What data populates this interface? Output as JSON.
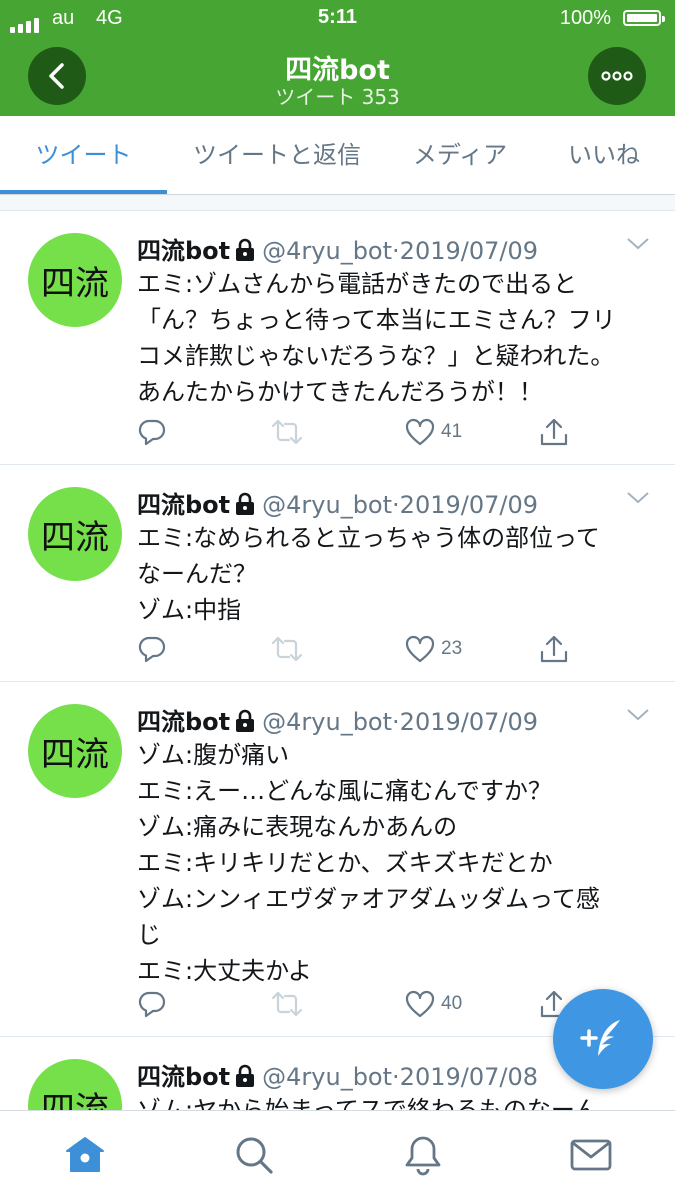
{
  "status_bar": {
    "carrier": "au",
    "network": "4G",
    "time": "5:11",
    "battery": "100%",
    "signal_bars": 4
  },
  "header": {
    "title": "四流bot",
    "subtitle": "ツイート 353",
    "color": "#47a534"
  },
  "tabs": [
    {
      "label": "ツイート",
      "active": true
    },
    {
      "label": "ツイートと返信",
      "active": false
    },
    {
      "label": "メディア",
      "active": false
    },
    {
      "label": "いいね",
      "active": false
    }
  ],
  "tweets": [
    {
      "avatar_text": "四流",
      "name": "四流bot",
      "handle": "@4ryu_bot",
      "date": "2019/07/09",
      "lines": [
        "エミ:ゾムさんから電話がきたので出ると",
        "「ん？ちょっと待って本当にエミさん？フリ",
        "コメ詐欺じゃないだろうな？」と疑われた。",
        "あんたからかけてきたんだろうが！！"
      ],
      "likes": "41"
    },
    {
      "avatar_text": "四流",
      "name": "四流bot",
      "handle": "@4ryu_bot",
      "date": "2019/07/09",
      "lines": [
        "エミ:なめられると立っちゃう体の部位って",
        "なーんだ？",
        "ゾム:中指"
      ],
      "likes": "23"
    },
    {
      "avatar_text": "四流",
      "name": "四流bot",
      "handle": "@4ryu_bot",
      "date": "2019/07/09",
      "lines": [
        "ゾム:腹が痛い",
        "エミ:えー…どんな風に痛むんですか？",
        "ゾム:痛みに表現なんかあんの",
        "エミ:キリキリだとか、ズキズキだとか",
        "ゾム:ンンィエヴダァオアダムッダムって感",
        "じ",
        "エミ:大丈夫かよ"
      ],
      "likes": "40"
    },
    {
      "avatar_text": "四流",
      "name": "四流bot",
      "handle": "@4ryu_bot",
      "date": "2019/07/08",
      "lines": [
        "ゾム:ヤから始まってスで終わるものなーん"
      ],
      "likes": ""
    }
  ],
  "icons": {
    "back": "chevron-left-icon",
    "more": "ellipsis-icon",
    "lock": "lock-icon",
    "caret": "chevron-down-icon",
    "reply": "reply-icon",
    "retweet": "retweet-icon",
    "like": "heart-icon",
    "share": "share-icon",
    "compose": "compose-tweet-icon",
    "home": "home-icon",
    "search": "search-icon",
    "notifications": "bell-icon",
    "messages": "mail-icon"
  },
  "accent": "#3d8fd8"
}
